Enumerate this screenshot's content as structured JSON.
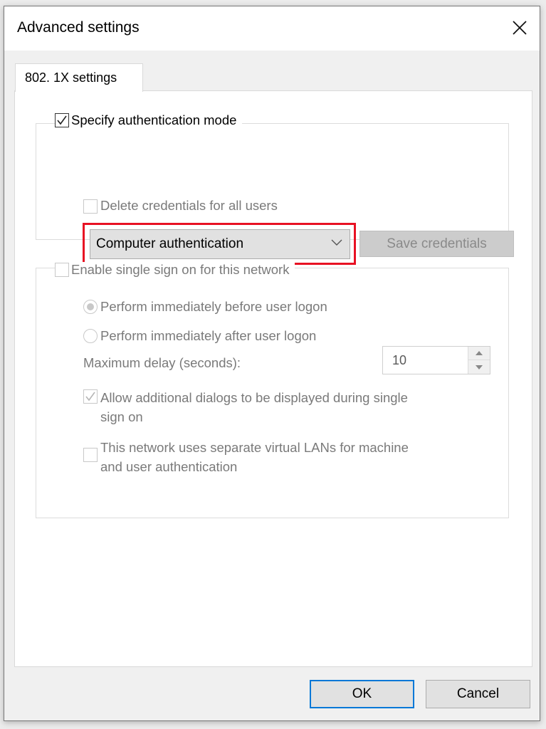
{
  "window": {
    "title": "Advanced settings",
    "close_icon": "close-icon"
  },
  "tabs": [
    {
      "label": "802. 1X settings",
      "active": true
    }
  ],
  "auth_group": {
    "specify_mode_label": "Specify authentication mode",
    "specify_mode_checked": true,
    "mode_dropdown": {
      "selected": "Computer authentication",
      "highlight_color": "#e81123"
    },
    "save_credentials_label": "Save credentials",
    "save_credentials_enabled": false,
    "delete_credentials_label": "Delete credentials for all users",
    "delete_credentials_checked": false
  },
  "sso_group": {
    "enable_sso_label": "Enable single sign on for this network",
    "enable_sso_checked": false,
    "radio_before_label": "Perform immediately before user logon",
    "radio_before_selected": true,
    "radio_after_label": "Perform immediately after user logon",
    "radio_after_selected": false,
    "max_delay_label": "Maximum delay (seconds):",
    "max_delay_value": "10",
    "allow_dialogs_label_line1": "Allow additional dialogs to be displayed during single",
    "allow_dialogs_label_line2": "sign on",
    "allow_dialogs_checked": true,
    "separate_vlans_label_line1": "This network uses separate virtual LANs for machine",
    "separate_vlans_label_line2": "and user authentication",
    "separate_vlans_checked": false
  },
  "footer": {
    "ok_label": "OK",
    "cancel_label": "Cancel",
    "accent_color": "#0078d7"
  }
}
